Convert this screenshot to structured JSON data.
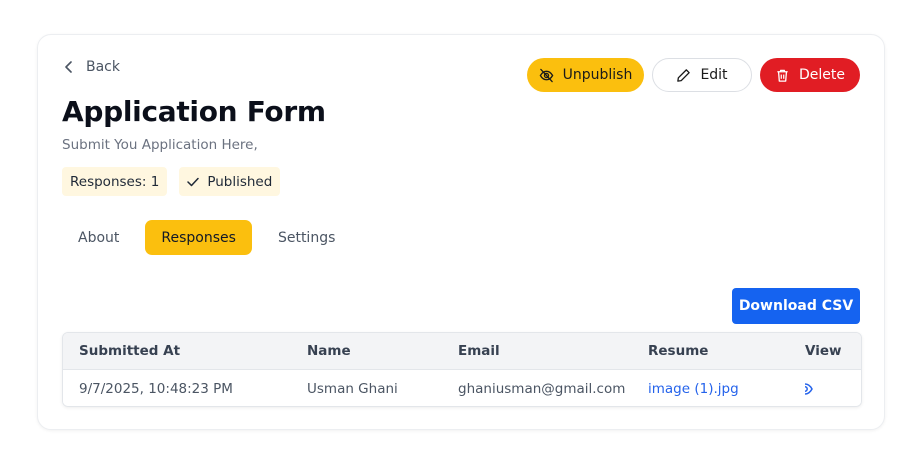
{
  "nav": {
    "back_label": "Back"
  },
  "form": {
    "title": "Application Form",
    "subtitle": "Submit You Application Here,",
    "responses_badge": "Responses: 1",
    "status_badge": "Published"
  },
  "actions": {
    "unpublish_label": "Unpublish",
    "edit_label": "Edit",
    "delete_label": "Delete"
  },
  "tabs": [
    {
      "label": "About"
    },
    {
      "label": "Responses"
    },
    {
      "label": "Settings"
    }
  ],
  "active_tab": "Responses",
  "download_csv_label": "Download CSV",
  "table": {
    "headers": [
      "Submitted At",
      "Name",
      "Email",
      "Resume",
      "View"
    ],
    "rows": [
      {
        "submitted_at": "9/7/2025, 10:48:23 PM",
        "name": "Usman Ghani",
        "email": "ghaniusman@gmail.com",
        "resume": "image (1).jpg",
        "view_icon": "eye-icon"
      }
    ]
  },
  "colors": {
    "accent_yellow": "#fbbf0e",
    "badge_bg": "#fff7e0",
    "danger_red": "#e11d24",
    "primary_blue": "#1563f0",
    "link_blue": "#2563eb"
  }
}
